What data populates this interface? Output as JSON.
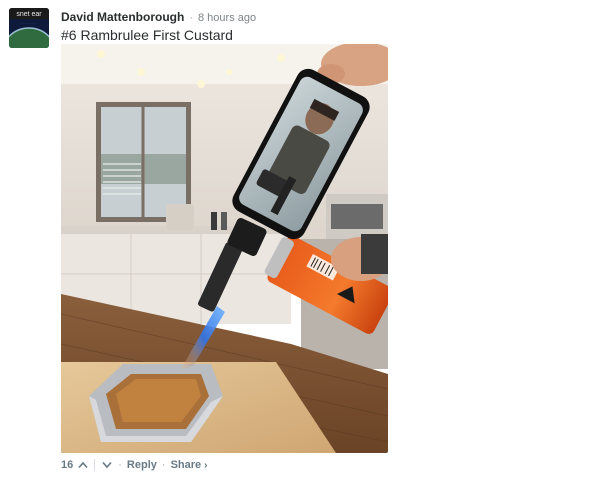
{
  "comment": {
    "author": "David Mattenborough",
    "separator": "·",
    "timestamp": "8 hours ago",
    "text": "#6 Rambrulee First Custard",
    "avatar": {
      "line1": "snet ear",
      "line2": "· · · · · · · · ·"
    },
    "image_alt": "Phone showing an action hero held over a blowtorch flaming a creme brulee in a kitchen"
  },
  "footer": {
    "votes": "16",
    "upvote_icon": "chevron-up-icon",
    "downvote_icon": "chevron-down-icon",
    "dot1": "·",
    "reply_label": "Reply",
    "dot2": "·",
    "share_label": "Share",
    "share_caret": "›"
  },
  "colors": {
    "author": "#2a2e2e",
    "meta": "#7d8487",
    "action": "#687a86",
    "flame": "#3b8bff"
  }
}
